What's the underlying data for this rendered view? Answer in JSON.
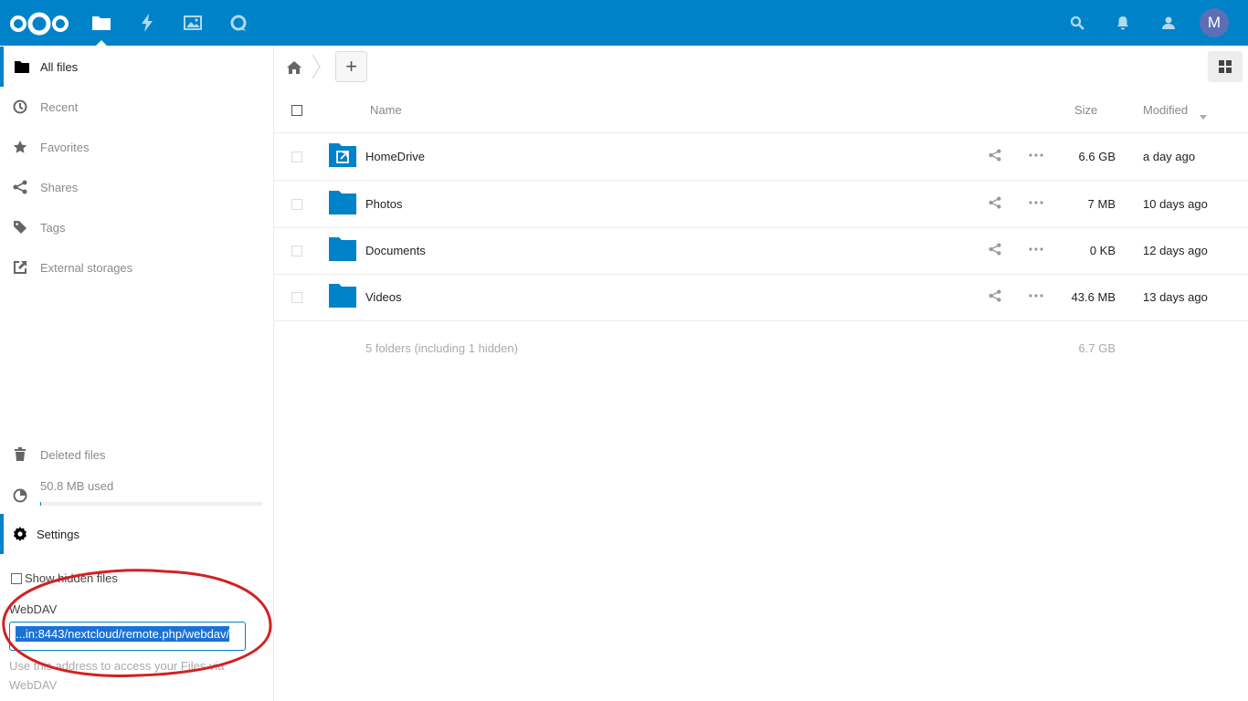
{
  "header": {
    "apps": [
      {
        "icon": "files-icon",
        "active": true
      },
      {
        "icon": "activity-icon",
        "active": false
      },
      {
        "icon": "gallery-icon",
        "active": false
      },
      {
        "icon": "talk-icon",
        "active": false
      }
    ],
    "right_icons": [
      "search-icon",
      "notifications-icon",
      "contacts-icon"
    ],
    "avatar_initial": "M",
    "accent_color": "#0082c9"
  },
  "sidebar": {
    "items": [
      {
        "label": "All files",
        "icon": "folder-icon",
        "active": true
      },
      {
        "label": "Recent",
        "icon": "clock-icon"
      },
      {
        "label": "Favorites",
        "icon": "star-icon"
      },
      {
        "label": "Shares",
        "icon": "share-icon"
      },
      {
        "label": "Tags",
        "icon": "tag-icon"
      },
      {
        "label": "External storages",
        "icon": "external-link-icon"
      }
    ],
    "deleted": "Deleted files",
    "quota": "50.8 MB used",
    "quota_fraction": 0.005,
    "settings": "Settings",
    "show_hidden": "Show hidden files",
    "webdav_label": "WebDAV",
    "webdav_value": "...in:8443/nextcloud/remote.php/webdav/",
    "webdav_hint": "Use this address to access your Files via WebDAV"
  },
  "table": {
    "headers": {
      "name": "Name",
      "size": "Size",
      "modified": "Modified"
    },
    "rows": [
      {
        "name": "HomeDrive",
        "size": "6.6 GB",
        "modified": "a day ago",
        "external": true
      },
      {
        "name": "Photos",
        "size": "7 MB",
        "modified": "10 days ago"
      },
      {
        "name": "Documents",
        "size": "0 KB",
        "modified": "12 days ago"
      },
      {
        "name": "Videos",
        "size": "43.6 MB",
        "modified": "13 days ago"
      }
    ],
    "summary": "5 folders (including 1 hidden)",
    "summary_size": "6.7 GB"
  }
}
